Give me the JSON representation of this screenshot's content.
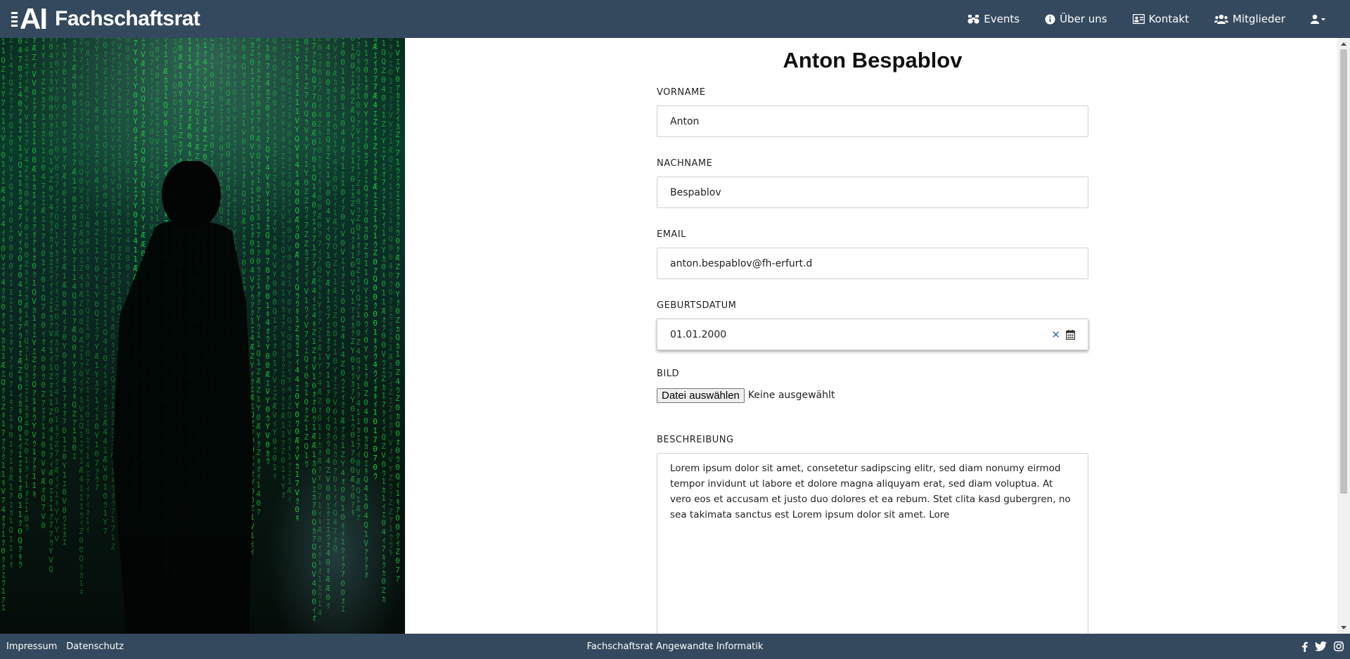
{
  "header": {
    "logo_text": "AI",
    "title": "Fachschaftsrat",
    "nav": [
      {
        "label": "Events",
        "icon": "binoculars-icon"
      },
      {
        "label": "Über uns",
        "icon": "info-circle-icon"
      },
      {
        "label": "Kontakt",
        "icon": "contact-card-icon"
      },
      {
        "label": "Mitglieder",
        "icon": "users-icon"
      }
    ],
    "user_menu_icon": "user-dropdown-icon"
  },
  "form": {
    "title": "Anton Bespablov",
    "vorname": {
      "label": "VORNAME",
      "value": "Anton"
    },
    "nachname": {
      "label": "NACHNAME",
      "value": "Bespablov"
    },
    "email": {
      "label": "EMAIL",
      "value": "anton.bespablov@fh-erfurt.d"
    },
    "geburtsdatum": {
      "label": "GEBURTSDATUM",
      "value": "01.01.2000"
    },
    "bild": {
      "label": "BILD",
      "button": "Datei auswählen",
      "status": "Keine ausgewählt"
    },
    "beschreibung": {
      "label": "BESCHREIBUNG",
      "value": "Lorem ipsum dolor sit amet, consetetur sadipscing elitr, sed diam nonumy eirmod tempor invidunt ut labore et dolore magna aliquyam erat, sed diam voluptua. At vero eos et accusam et justo duo dolores et ea rebum. Stet clita kasd gubergren, no sea takimata sanctus est Lorem ipsum dolor sit amet. Lore"
    }
  },
  "footer": {
    "links": [
      "Impressum",
      "Datenschutz"
    ],
    "center": "Fachschaftsrat Angewandte Informatik",
    "social": [
      "facebook-icon",
      "twitter-icon",
      "instagram-icon"
    ]
  },
  "colors": {
    "navbar": "#34495e",
    "matrix_green": "#1fd33b"
  }
}
